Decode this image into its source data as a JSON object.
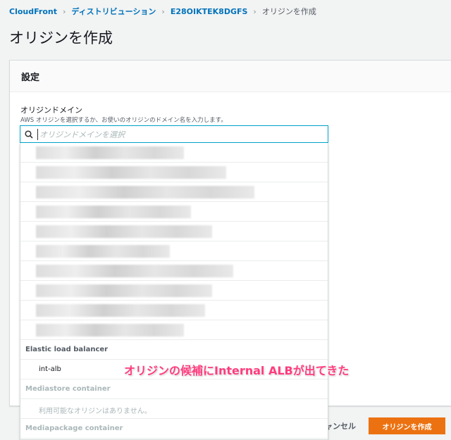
{
  "breadcrumb": [
    "CloudFront",
    "ディストリビューション",
    "E28OIKTEK8DGFS",
    "オリジンを作成"
  ],
  "page_title": "オリジンを作成",
  "section_title": "設定",
  "field": {
    "label": "オリジンドメイン",
    "description": "AWS オリジンを選択するか、お使いのオリジンのドメイン名を入力します。",
    "placeholder": "オリジンドメインを選択"
  },
  "dropdown": {
    "elb_group": "Elastic load balancer",
    "elb_option": "int-alb",
    "mediastore_group": "Mediastore container",
    "mediastore_empty": "利用可能なオリジンはありません。",
    "mediapackage_group": "Mediapackage container"
  },
  "buttons": {
    "cancel": "キャンセル",
    "create": "オリジンを作成"
  },
  "annotation": "オリジンの候補にInternal ALBが出てきた"
}
